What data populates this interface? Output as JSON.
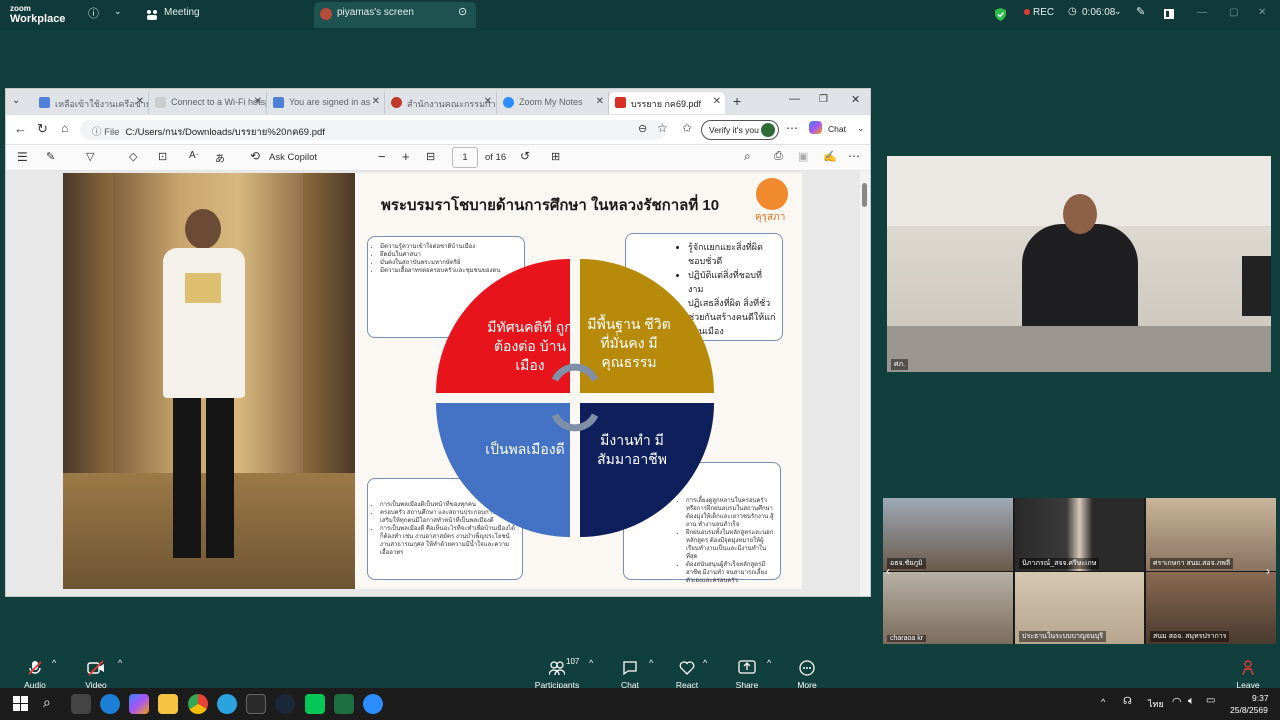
{
  "zoom": {
    "logo_line1": "zoom",
    "logo_line2": "Workplace",
    "meeting_label": "Meeting",
    "share_tab_label": "piyamas's screen",
    "rec_label": "REC",
    "timer": "0:06:08"
  },
  "browser": {
    "tabs": [
      {
        "label": "เหลือเข้าใช้งานเครือข่ายฯ",
        "active": false
      },
      {
        "label": "Connect to a Wi-Fi hotsp",
        "active": false
      },
      {
        "label": "You are signed in as",
        "active": false
      },
      {
        "label": "สำนักงานคณะกรรมการ",
        "active": false
      },
      {
        "label": "Zoom My Notes",
        "active": false
      },
      {
        "label": "บรรยาย กค69.pdf",
        "active": true
      }
    ],
    "address_prefix": "File",
    "address": "C:/Users/กนร/Downloads/บรรยาย%20กค69.pdf",
    "verify_label": "Verify it's you",
    "chat_label": "Chat",
    "copilot_label": "Ask Copilot",
    "page_current": "1",
    "page_total": "of 16"
  },
  "slide": {
    "title": "พระบรมราโชบายด้านการศึกษา ในหลวงรัชกาลที่ 10",
    "logo_text": "คุรุสภา",
    "quadrants": {
      "top_left": "มีทัศนคติที่ ถูกต้องต่อ บ้านเมือง",
      "top_right": "มีพื้นฐาน ชีวิตที่มั่นคง มีคุณธรรม",
      "bottom_left": "เป็นพลเมืองดี",
      "bottom_right": "มีงานทำ มีสัมมาอาชีพ"
    },
    "box_tl": [
      "มีความรู้ความเข้าใจต่อชาติบ้านเมือง",
      "ยึดมั่นในศาสนา",
      "มั่นคงในสถาบันพระมหากษัตริย์",
      "มีความเอื้ออาทรต่อครอบครัวและชุมชนของตน"
    ],
    "box_tr": [
      "รู้จักแยกแยะสิ่งที่ผิดชอบชั่วดี",
      "ปฏิบัติแต่สิ่งที่ชอบที่งาม",
      "ปฏิเสธสิ่งที่ผิด สิ่งที่ชั่ว",
      "ช่วยกันสร้างคนดีให้แก่บ้านเมือง"
    ],
    "box_bl": [
      "การเป็นพลเมืองดีเป็นหน้าที่ของทุกคน",
      "ครอบครัว สถานศึกษา และสถานประกอบการต้องส่งเสริมให้ทุกคนมีโอกาสทำหน้าที่เป็นพลเมืองดี",
      "การเป็นพลเมืองดี คือเห็นอะไรที่จะทำเพื่อบ้านเมืองได้ก็ต้องทำ เช่น งานอาสาสมัคร งานบำเพ็ญประโยชน์ งานสาธารณกุศล ให้ทำด้วยความมีน้ำใจและความเอื้ออาทร"
    ],
    "box_br": [
      "การเลี้ยงดูลูกหลานในครอบครัว หรือการฝึกฝนอบรมในสถานศึกษา ต้องมุ่งให้เด็กและเยาวชนรักงาน สู้งาน ทำงานจนสำเร็จ",
      "ฝึกฝนอบรมทั้งในหลักสูตรและนอกหลักสูตร ต้องมีจุดมุ่งหมายให้ผู้เรียนทำงานเป็นและมีงานทำในที่สุด",
      "ต้องสนับสนุนผู้สำเร็จหลักสูตรมีอาชีพ มีงานทำ จนสามารถเลี้ยงตัวเองและครอบครัว"
    ]
  },
  "participants_video": {
    "speaker_name": "ศภ.",
    "tiles": [
      {
        "name": "อธจ.ชัยภูมิ"
      },
      {
        "name": "นิภาภรณ์_สจจ.ศรีษะเกษ"
      },
      {
        "name": "ศราเกษกา สนม.สอจ.ภพลี"
      },
      {
        "name": "charaoa kr"
      },
      {
        "name": "ประธานในระบบบาญจนบุรี"
      },
      {
        "name": "สนม สอจ. สมุทรปราการ"
      }
    ]
  },
  "controls": {
    "audio": "Audio",
    "video": "Video",
    "participants": "Participants",
    "participants_count": "107",
    "chat": "Chat",
    "react": "React",
    "share": "Share",
    "more": "More",
    "leave": "Leave"
  },
  "taskbar": {
    "lang": "ไทย",
    "time": "9:37",
    "date": "25/8/2569"
  }
}
